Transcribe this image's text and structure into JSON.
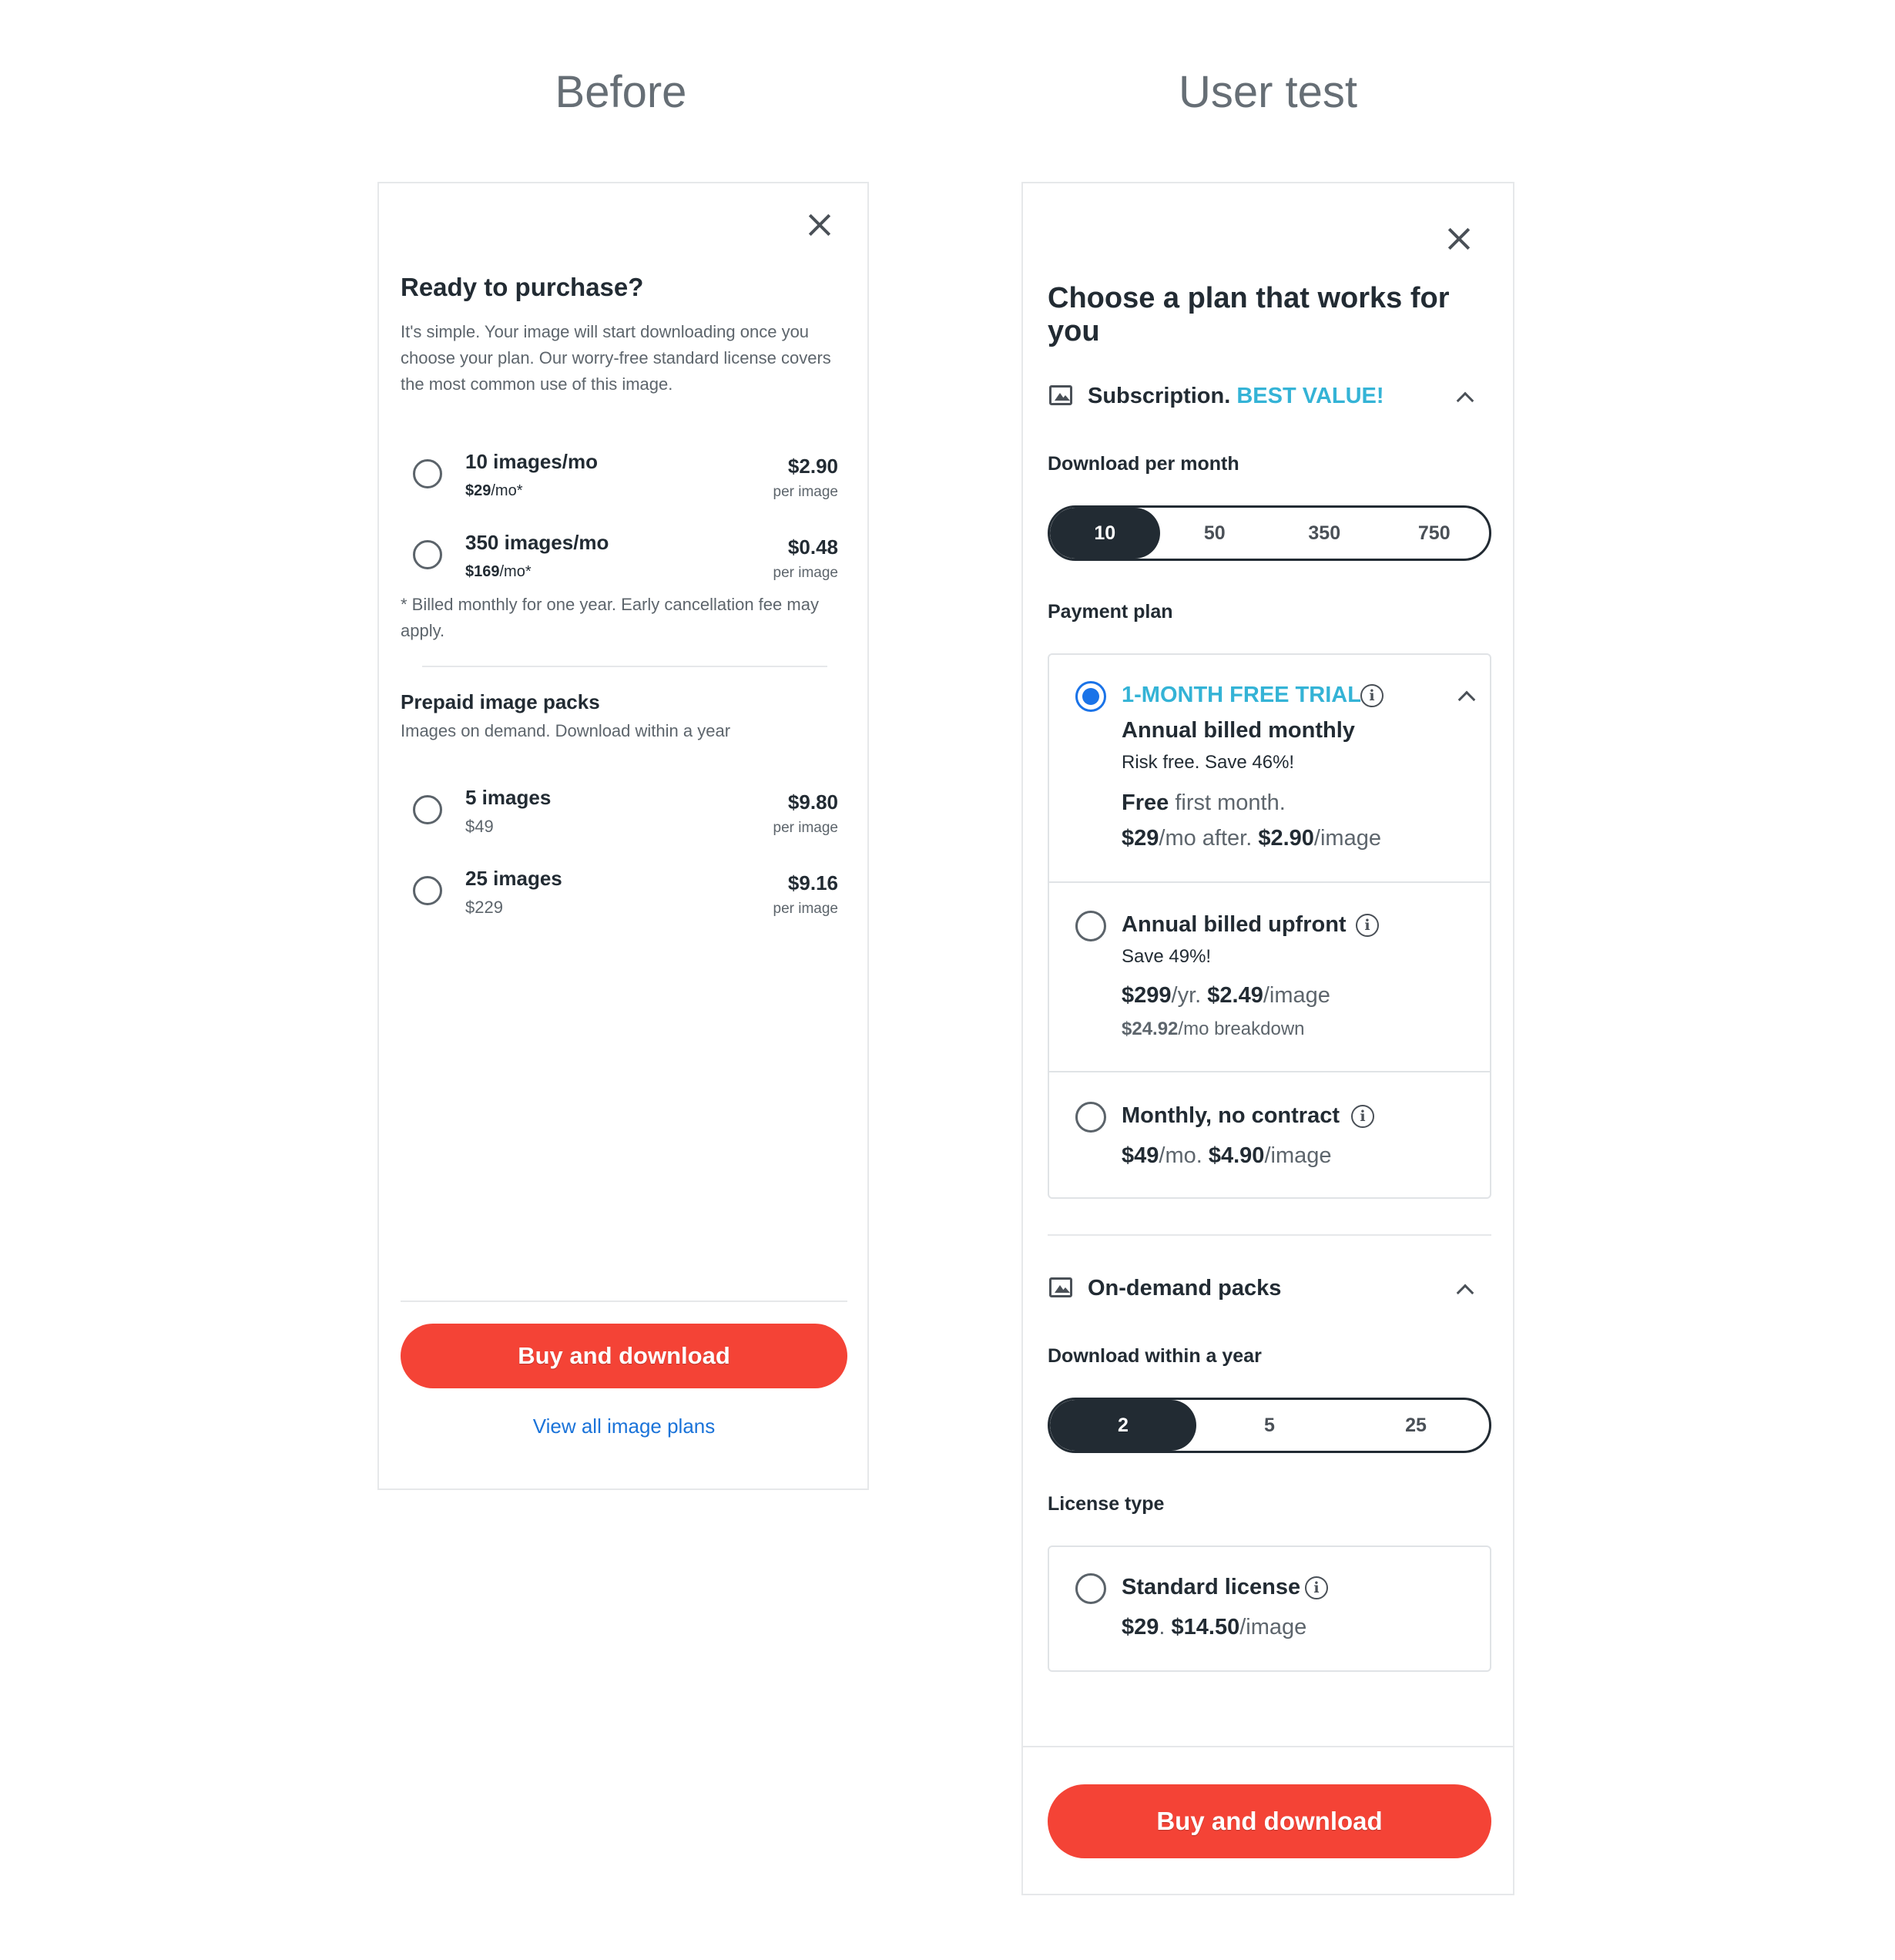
{
  "headings": {
    "before": "Before",
    "user_test": "User test"
  },
  "before": {
    "title": "Ready to purchase?",
    "description": "It's simple. Your image will start downloading once you choose your plan. Our worry-free standard license covers the most common use of this image.",
    "subscription_options": [
      {
        "name": "10 images/mo",
        "sub_price": "$29",
        "sub_unit": "/mo*",
        "price": "$2.90",
        "per": "per image"
      },
      {
        "name": "350 images/mo",
        "sub_price": "$169",
        "sub_unit": "/mo*",
        "price": "$0.48",
        "per": "per image"
      }
    ],
    "footnote": "* Billed monthly for one year. Early cancellation fee may apply.",
    "packs_title": "Prepaid image packs",
    "packs_subtitle": "Images on demand. Download within a year",
    "pack_options": [
      {
        "name": "5 images",
        "sub": "$49",
        "price": "$9.80",
        "per": "per image"
      },
      {
        "name": "25 images",
        "sub": "$229",
        "price": "$9.16",
        "per": "per image"
      }
    ],
    "buy_label": "Buy and download",
    "link_label": "View all image plans"
  },
  "user_test": {
    "title": "Choose a plan that works for you",
    "subscription": {
      "label": "Subscription.",
      "badge": "BEST VALUE!",
      "download_label": "Download per month",
      "segments": [
        "10",
        "50",
        "350",
        "750"
      ],
      "selected_segment": "10",
      "payment_label": "Payment plan",
      "plans": [
        {
          "accent_title": "1-MONTH FREE TRIAL",
          "title": "Annual billed monthly",
          "sub": "Risk free. Save 46%!",
          "line1_bold": "Free",
          "line1_rest": " first month.",
          "line2_bold1": "$29",
          "line2_mid": "/mo after. ",
          "line2_bold2": "$2.90",
          "line2_rest": "/image",
          "selected": true
        },
        {
          "title": "Annual billed upfront",
          "sub": "Save 49%!",
          "line1_bold1": "$299",
          "line1_mid": "/yr. ",
          "line1_bold2": "$2.49",
          "line1_rest": "/image",
          "line2_bold": "$24.92",
          "line2_rest": "/mo breakdown",
          "selected": false
        },
        {
          "title": "Monthly, no contract",
          "line1_bold1": "$49",
          "line1_mid": "/mo. ",
          "line1_bold2": "$4.90",
          "line1_rest": "/image",
          "selected": false
        }
      ]
    },
    "packs": {
      "label": "On-demand packs",
      "download_label": "Download within a year",
      "segments": [
        "2",
        "5",
        "25"
      ],
      "selected_segment": "2",
      "license_label": "License type",
      "license": {
        "title": "Standard license",
        "bold1": "$29",
        "mid": ". ",
        "bold2": "$14.50",
        "rest": "/image"
      }
    },
    "buy_label": "Buy and download"
  },
  "colors": {
    "accent": "#34b3d6",
    "cta": "#f44336",
    "dark": "#222b33",
    "link": "#1a73d9",
    "radio_selected": "#1a73e8"
  },
  "icons": [
    "close-icon",
    "image-icon",
    "chevron-up-icon",
    "info-icon",
    "radio-icon"
  ]
}
